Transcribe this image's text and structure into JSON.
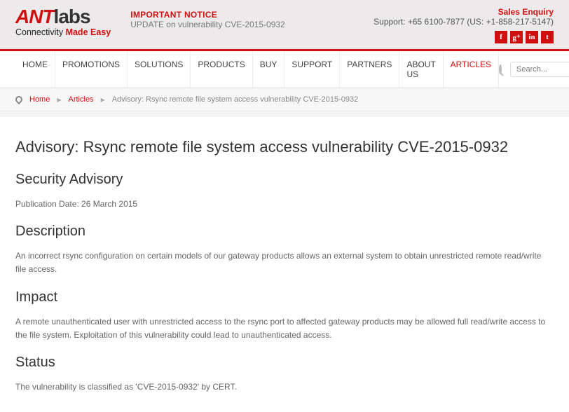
{
  "logo": {
    "ant": "ANT",
    "labs": "labs",
    "tagline_a": "Connectivity ",
    "tagline_b": "Made Easy"
  },
  "notice": {
    "title": "IMPORTANT NOTICE",
    "link": "UPDATE on vulnerability CVE-2015-0932"
  },
  "contact": {
    "sales": "Sales Enquiry",
    "support": "Support: +65 6100-7877 (US: +1-858-217-5147)"
  },
  "social": {
    "fb": "f",
    "gp": "g⁺",
    "in": "in",
    "tw": "t"
  },
  "nav": {
    "home": "HOME",
    "promotions": "PROMOTIONS",
    "solutions": "SOLUTIONS",
    "products": "PRODUCTS",
    "buy": "BUY",
    "support": "SUPPORT",
    "partners": "PARTNERS",
    "about": "ABOUT US",
    "articles": "ARTICLES"
  },
  "search": {
    "placeholder": "Search..."
  },
  "crumbs": {
    "home": "Home",
    "articles": "Articles",
    "current": "Advisory: Rsync remote file system access vulnerability CVE-2015-0932"
  },
  "article": {
    "title": "Advisory: Rsync remote file system access vulnerability CVE-2015-0932",
    "h_advisory": "Security Advisory",
    "pubdate": "Publication Date: 26 March 2015",
    "h_desc": "Description",
    "p_desc": "An incorrect rsync configuration on certain models of our gateway products allows an external system to obtain unrestricted remote read/write file access.",
    "h_impact": "Impact",
    "p_impact": "A remote unauthenticated user with unrestricted access to the rsync port to affected gateway products may be allowed full read/write access to the file system. Exploitation of this vulnerability could lead to unauthenticated access.",
    "h_status": "Status",
    "p_status": "The vulnerability is classified as 'CVE-2015-0932' by CERT."
  }
}
